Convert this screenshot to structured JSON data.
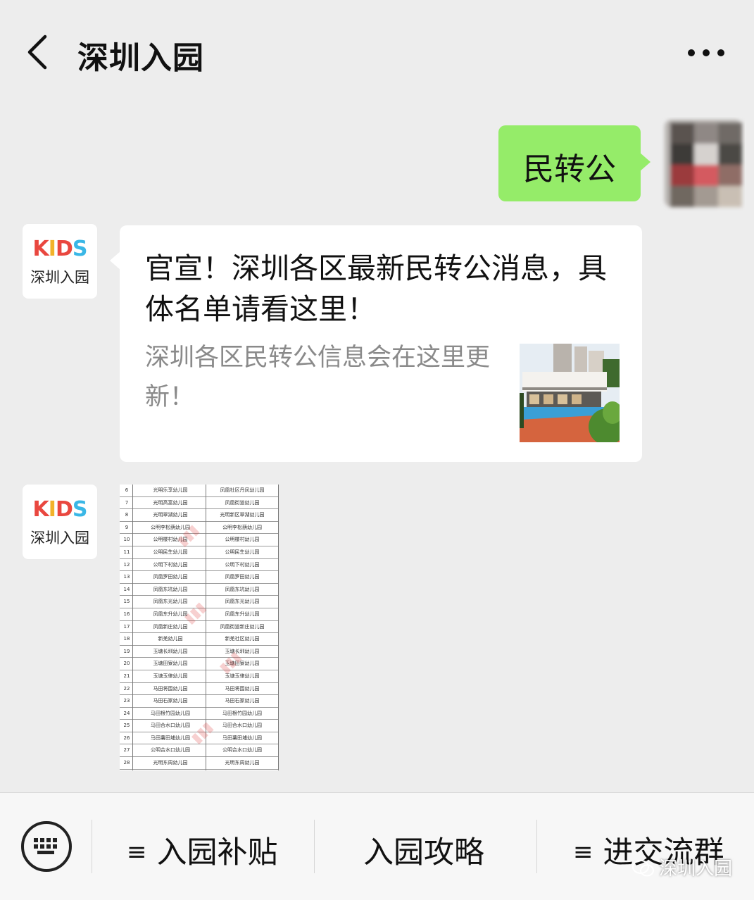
{
  "header": {
    "title": "深圳入园",
    "back_icon": "chevron-left-icon",
    "more_icon": "more-dots-icon"
  },
  "messages": {
    "sent": {
      "text": "民转公"
    },
    "account": {
      "logo_text": "KIDS",
      "name": "深圳入园"
    },
    "article": {
      "title": "官宣！深圳各区最新民转公消息，具体名单请看这里！",
      "description": "深圳各区民转公信息会在这里更新！"
    },
    "sheet": {
      "rows": [
        [
          "6",
          "光明乐享幼儿园",
          "凤凰社区丹凤幼儿园"
        ],
        [
          "7",
          "光明高富幼儿园",
          "凤凰街道幼儿园"
        ],
        [
          "8",
          "光明翠湖幼儿园",
          "光明新区翠湖幼儿园"
        ],
        [
          "9",
          "公明李松蓢幼儿园",
          "公明李松蓢幼儿园"
        ],
        [
          "10",
          "公明楼村幼儿园",
          "公明楼村幼儿园"
        ],
        [
          "11",
          "公明民生幼儿园",
          "公明民生幼儿园"
        ],
        [
          "12",
          "公明下村幼儿园",
          "公明下村幼儿园"
        ],
        [
          "13",
          "凤凰罗田幼儿园",
          "凤凰罗田幼儿园"
        ],
        [
          "14",
          "凤凰东坑幼儿园",
          "凤凰东坑幼儿园"
        ],
        [
          "15",
          "凤凰东光幼儿园",
          "凤凰东光幼儿园"
        ],
        [
          "16",
          "凤凰东升幼儿园",
          "凤凰东升幼儿园"
        ],
        [
          "17",
          "凤凰新庄幼儿园",
          "凤凰街道新庄幼儿园"
        ],
        [
          "18",
          "新羌幼儿园",
          "新羌社区幼儿园"
        ],
        [
          "19",
          "玉塘长圳幼儿园",
          "玉塘长圳幼儿园"
        ],
        [
          "20",
          "玉塘田寮幼儿园",
          "玉塘田寮幼儿园"
        ],
        [
          "21",
          "玉塘玉律幼儿园",
          "玉塘玉律幼儿园"
        ],
        [
          "22",
          "马田将围幼儿园",
          "马田将围幼儿园"
        ],
        [
          "23",
          "马田石家幼儿园",
          "马田石家幼儿园"
        ],
        [
          "24",
          "马田根竹园幼儿园",
          "马田根竹园幼儿园"
        ],
        [
          "25",
          "马田合水口幼儿园",
          "马田合水口幼儿园"
        ],
        [
          "26",
          "马田薯田埔幼儿园",
          "马田薯田埔幼儿园"
        ],
        [
          "27",
          "公明合水口幼儿园",
          "公明合水口幼儿园"
        ],
        [
          "28",
          "光明东周幼儿园",
          "光明东周幼儿园"
        ],
        [
          "29",
          "光明碧眼幼儿园",
          "光明碧眼幼儿园"
        ],
        [
          "30",
          "光明白花幼儿园",
          "光明白花社区幼儿园"
        ]
      ]
    }
  },
  "menu": {
    "keyboard_icon": "keyboard-icon",
    "items": [
      {
        "label": "入园补贴",
        "icon": "≡"
      },
      {
        "label": "入园攻略"
      },
      {
        "label": "进交流群",
        "icon": "≡"
      }
    ]
  },
  "watermark": {
    "text": "深圳入园"
  },
  "colors": {
    "sent_bubble": "#95ec69",
    "background": "#ededed",
    "secondary_text": "#8a8a8a"
  }
}
